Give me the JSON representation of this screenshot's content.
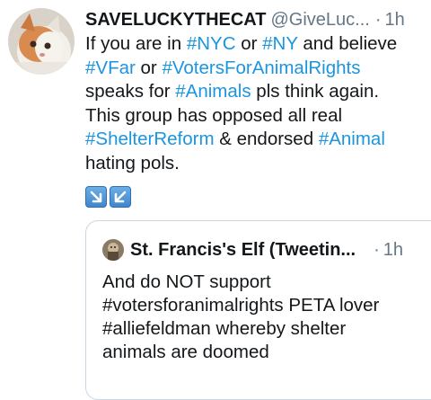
{
  "tweet": {
    "display_name": "SAVELUCKYTHECAT",
    "handle": "@GiveLuc...",
    "dot": "·",
    "time": "1h",
    "avatar_icon": "cat-avatar",
    "text_lines": [
      [
        {
          "t": "If  you are in ",
          "h": false
        },
        {
          "t": "#NYC",
          "h": true
        },
        {
          "t": " or ",
          "h": false
        },
        {
          "t": "#NY",
          "h": true
        },
        {
          "t": " and believe",
          "h": false
        }
      ],
      [
        {
          "t": "#VFar",
          "h": true
        },
        {
          "t": " or ",
          "h": false
        },
        {
          "t": "#VotersForAnimalRights",
          "h": true
        }
      ],
      [
        {
          "t": "speaks for ",
          "h": false
        },
        {
          "t": "#Animals",
          "h": true
        },
        {
          "t": " pls think again.",
          "h": false
        }
      ],
      [
        {
          "t": "This group has opposed all real",
          "h": false
        }
      ],
      [
        {
          "t": "#ShelterReform",
          "h": true
        },
        {
          "t": " & endorsed ",
          "h": false
        },
        {
          "t": "#Animal",
          "h": true
        }
      ],
      [
        {
          "t": "hating pols.",
          "h": false
        }
      ]
    ],
    "emojis": [
      "down-right-arrow-icon",
      "down-left-arrow-icon"
    ],
    "colors": {
      "hashtag": "#1b95e0",
      "secondary": "#657786",
      "text": "#14171a",
      "card_border": "#ccd6dd"
    }
  },
  "quote": {
    "display_name": "St. Francis's Elf (Tweetin...",
    "dot": "·",
    "time": "1h",
    "avatar_icon": "elf-avatar",
    "text_lines": [
      "And do NOT support",
      "#votersforanimalrights PETA lover",
      "#alliefeldman whereby shelter",
      "animals are doomed"
    ]
  }
}
